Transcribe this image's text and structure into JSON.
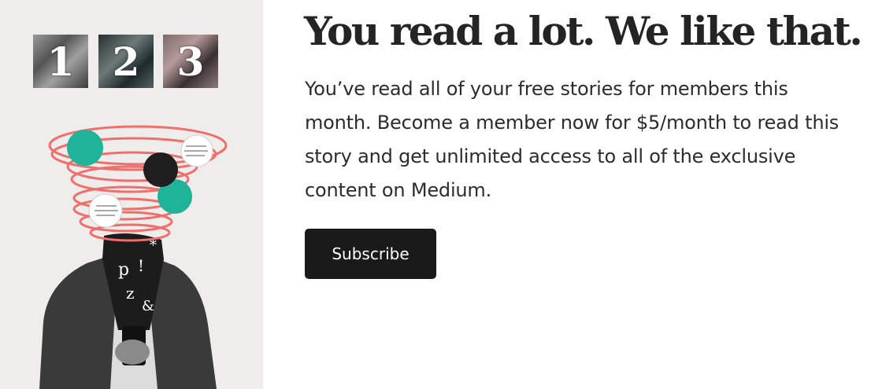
{
  "illustration": {
    "tiles": [
      "1",
      "2",
      "3"
    ],
    "colors": {
      "accent_teal": "#1fb39a",
      "swirl_red": "#ef6f6c",
      "panel_bg": "#efedeb"
    }
  },
  "paywall": {
    "headline": "You read a lot. We like that.",
    "body": "You’ve read all of your free stories for members this month. Become a member now for $5/month to read this story and get unlimited access to all of the exclusive content on Medium.",
    "subscribe_label": "Subscribe"
  }
}
